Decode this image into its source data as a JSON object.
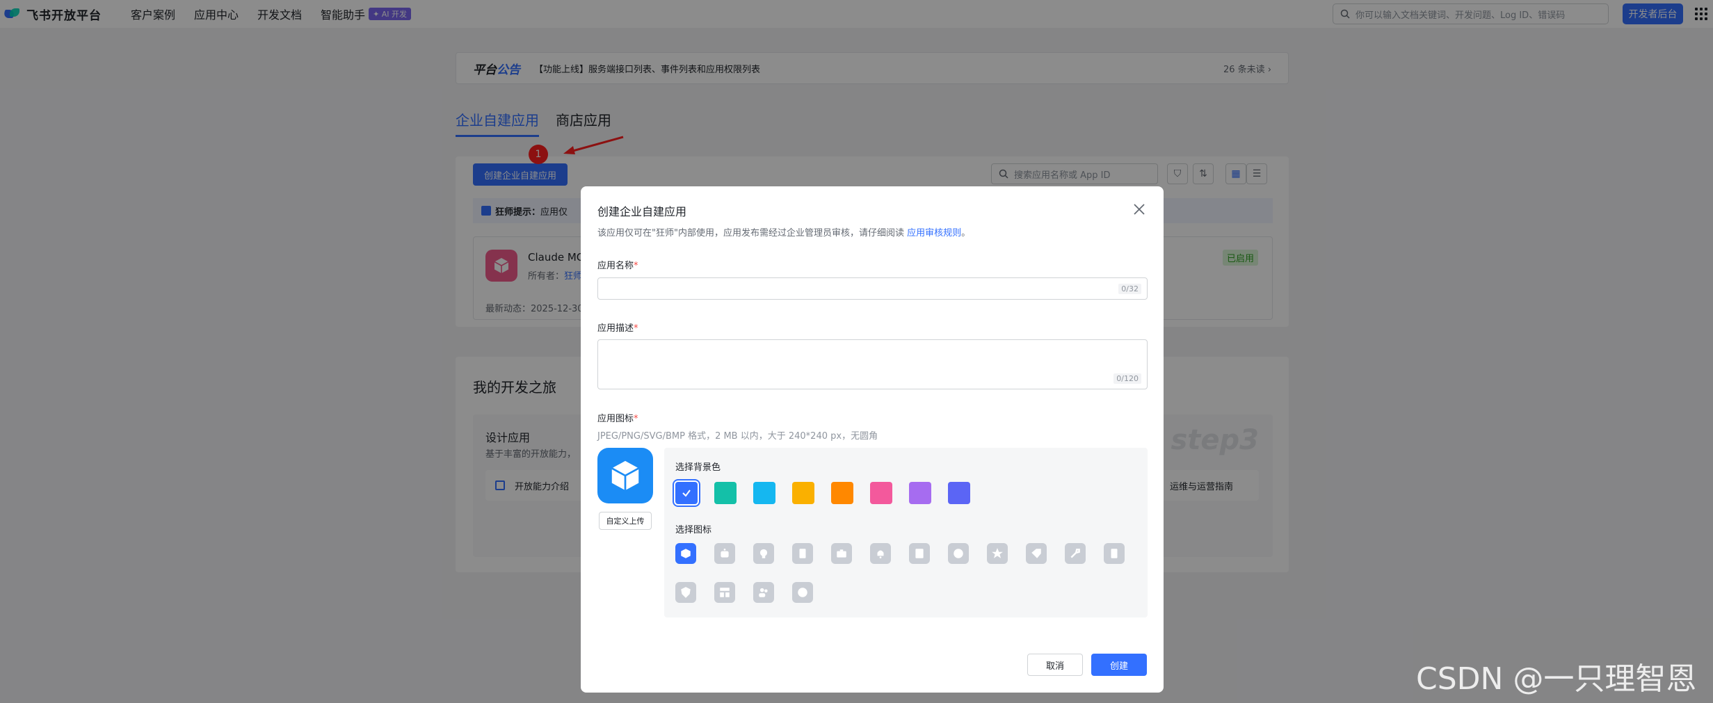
{
  "topnav": {
    "logo_text": "飞书开放平台",
    "links": [
      "客户案例",
      "应用中心",
      "开发文档",
      "智能助手"
    ],
    "ai_badge": "✦ AI 开发",
    "search_placeholder": "你可以输入文档关键词、开发问题、Log ID、错误码",
    "dev_console": "开发者后台"
  },
  "notice": {
    "brand_a": "平台",
    "brand_b": "公告",
    "text": "【功能上线】服务端接口列表、事件列表和应用权限列表",
    "unread": "26 条未读 ›"
  },
  "tabs": [
    "企业自建应用",
    "商店应用"
  ],
  "toolbar": {
    "create_button": "创建企业自建应用",
    "search_placeholder": "搜索应用名称或 App ID"
  },
  "tip": {
    "label": "狂师提示：",
    "text": "应用仅"
  },
  "app": {
    "name": "Claude MC",
    "owner_label": "所有者：",
    "owner_value": "狂师",
    "status": "已启用",
    "recent": "最新动态：2025-12-30"
  },
  "journey": {
    "title": "我的开发之旅",
    "panel_title": "设计应用",
    "panel_desc": "基于丰富的开放能力，",
    "link_left": "开放能力介绍",
    "link_right": "运维与运营指南",
    "step": "step3"
  },
  "annotation": {
    "number": "1"
  },
  "modal": {
    "title": "创建企业自建应用",
    "subtitle": "该应用仅可在\"狂师\"内部使用，应用发布需经过企业管理员审核，请仔细阅读",
    "subtitle_link": "应用审核规则",
    "subtitle_end": "。",
    "name_label": "应用名称",
    "name_count": "0/32",
    "desc_label": "应用描述",
    "desc_count": "0/120",
    "icon_label": "应用图标",
    "required_mark": "*",
    "icon_hint": "JPEG/PNG/SVG/BMP 格式，2 MB 以内，大于 240*240 px，无圆角",
    "upload_button": "自定义上传",
    "bg_label": "选择背景色",
    "icon_pick_label": "选择图标",
    "bg_colors": [
      "#3370ff",
      "#14c0a8",
      "#15b7f0",
      "#fab000",
      "#ff8800",
      "#f3599c",
      "#a66cf0",
      "#5b65f5"
    ],
    "icons": [
      "cube-icon",
      "robot-icon",
      "bulb-icon",
      "document-icon",
      "briefcase-icon",
      "bell-icon",
      "checklist-icon",
      "pie-icon",
      "star-icon",
      "tag-icon",
      "wrench-icon",
      "file-icon",
      "shield-icon",
      "layout-icon",
      "people-icon",
      "code-icon"
    ],
    "cancel": "取消",
    "create": "创建"
  },
  "watermark": "CSDN @一只理智恩"
}
